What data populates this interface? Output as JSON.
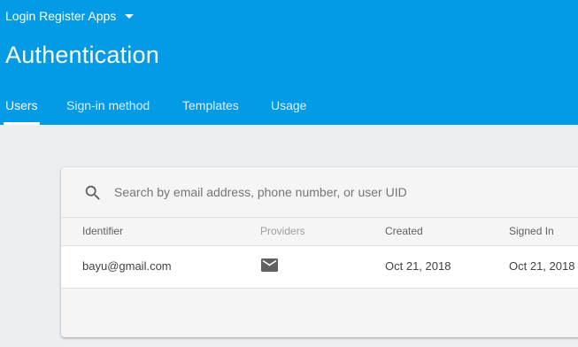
{
  "header": {
    "project_name": "Login Register Apps",
    "title": "Authentication",
    "tabs": [
      {
        "label": "Users",
        "active": true
      },
      {
        "label": "Sign-in method",
        "active": false
      },
      {
        "label": "Templates",
        "active": false
      },
      {
        "label": "Usage",
        "active": false
      }
    ]
  },
  "search": {
    "placeholder": "Search by email address, phone number, or user UID",
    "value": ""
  },
  "table": {
    "columns": [
      "Identifier",
      "Providers",
      "Created",
      "Signed In"
    ],
    "rows": [
      {
        "identifier": "bayu@gmail.com",
        "provider_icon": "email-icon",
        "created": "Oct 21, 2018",
        "signed_in": "Oct 21, 2018"
      }
    ]
  },
  "colors": {
    "header_bg": "#039be5",
    "page_bg": "#eceff1",
    "card_bg": "#f5f5f5"
  },
  "icons": {
    "project_dropdown": "caret-down-icon",
    "search": "search-icon",
    "provider": "email-icon"
  }
}
